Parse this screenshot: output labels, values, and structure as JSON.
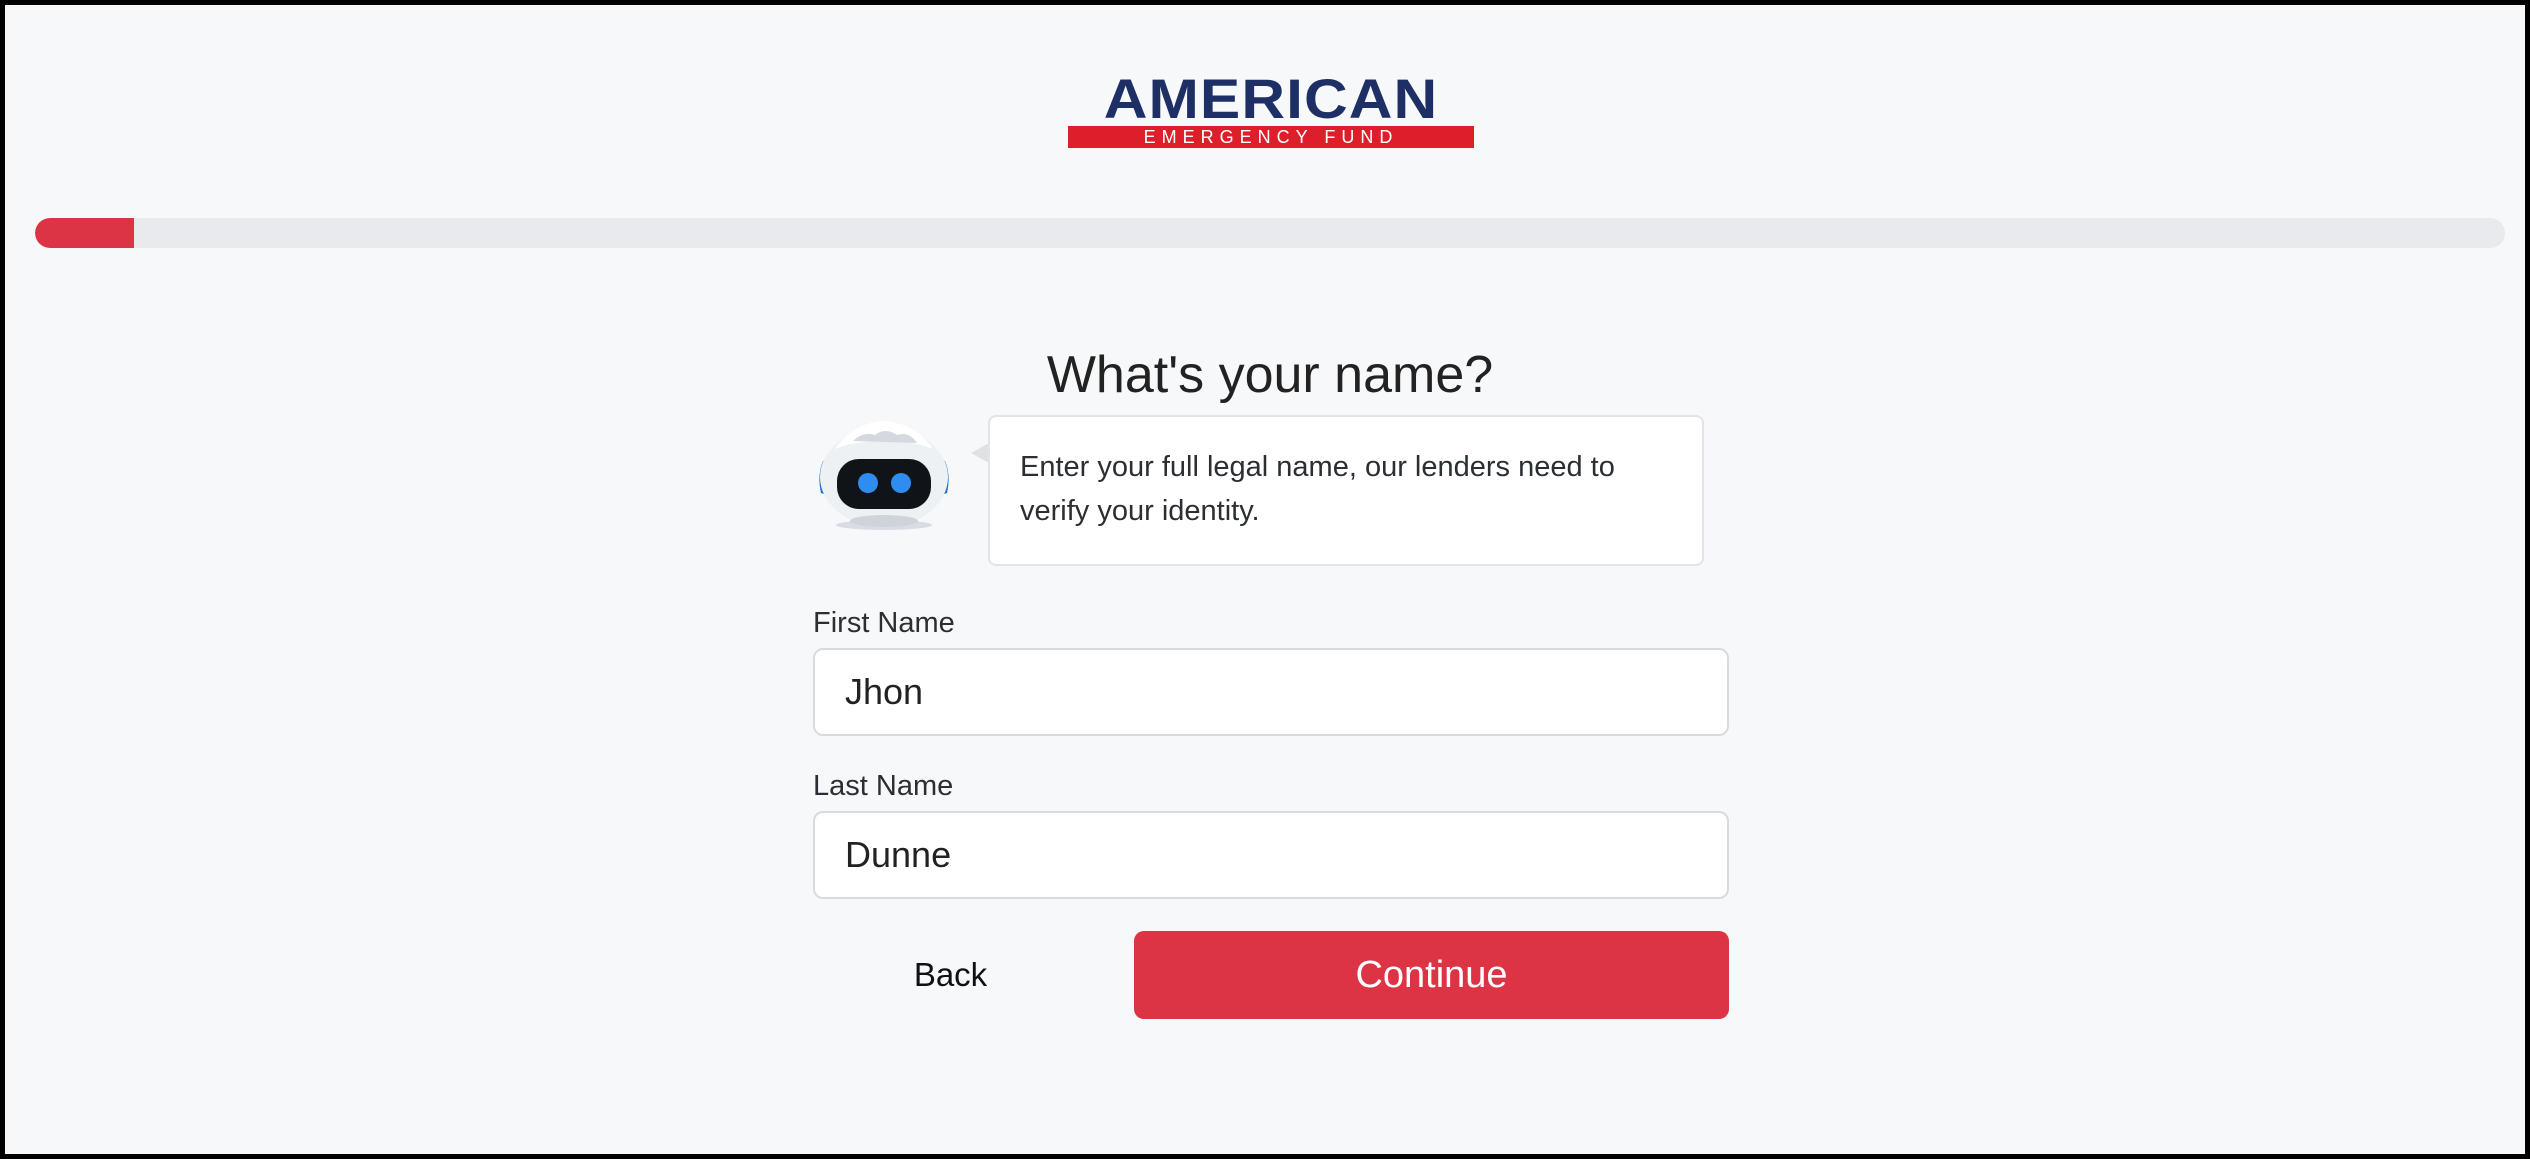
{
  "brand": {
    "logo_word": "AMERICAN",
    "logo_tagline": "EMERGENCY FUND",
    "primary_color": "#1e2f66",
    "accent_color": "#dc1f2b"
  },
  "progress": {
    "fraction": 0.04,
    "color": "#dd3445"
  },
  "page": {
    "title": "What's your name?"
  },
  "assistant": {
    "icon": "robot-icon",
    "message": "Enter your full legal name, our lenders need to verify your identity."
  },
  "form": {
    "first_name": {
      "label": "First Name",
      "value": "Jhon"
    },
    "last_name": {
      "label": "Last Name",
      "value": "Dunne"
    }
  },
  "actions": {
    "back_label": "Back",
    "continue_label": "Continue"
  }
}
